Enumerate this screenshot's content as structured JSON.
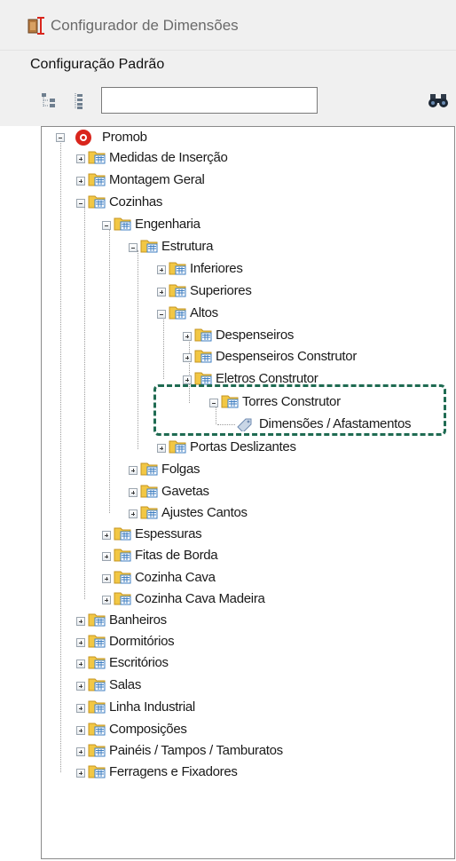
{
  "window": {
    "title": "Configurador de Dimensões"
  },
  "header": {
    "title": "Configuração Padrão"
  },
  "toolbar": {
    "search_value": "",
    "search_placeholder": ""
  },
  "colors": {
    "highlight": "#1f6b52",
    "folder": "#f4c842",
    "root_icon": "#d9251c"
  },
  "tree": {
    "root": "Promob",
    "nodes": [
      {
        "id": "medidas",
        "label": "Medidas de Inserção",
        "state": "collapsed"
      },
      {
        "id": "montagem",
        "label": "Montagem Geral",
        "state": "collapsed"
      },
      {
        "id": "cozinhas",
        "label": "Cozinhas",
        "state": "expanded"
      },
      {
        "id": "engenharia",
        "label": "Engenharia",
        "state": "expanded"
      },
      {
        "id": "estrutura",
        "label": "Estrutura",
        "state": "expanded"
      },
      {
        "id": "inferiores",
        "label": "Inferiores",
        "state": "collapsed"
      },
      {
        "id": "superiores",
        "label": "Superiores",
        "state": "collapsed"
      },
      {
        "id": "altos",
        "label": "Altos",
        "state": "expanded"
      },
      {
        "id": "despenseiros",
        "label": "Despenseiros",
        "state": "collapsed"
      },
      {
        "id": "despenseiros_construtor",
        "label": "Despenseiros Construtor",
        "state": "collapsed"
      },
      {
        "id": "eletros_construtor",
        "label": "Eletros Construtor",
        "state": "collapsed"
      },
      {
        "id": "torres_construtor",
        "label": "Torres Construtor",
        "state": "expanded"
      },
      {
        "id": "dimensoes",
        "label": "Dimensões / Afastamentos",
        "state": "leaf"
      },
      {
        "id": "portas",
        "label": "Portas Deslizantes",
        "state": "collapsed"
      },
      {
        "id": "folgas",
        "label": "Folgas",
        "state": "collapsed"
      },
      {
        "id": "gavetas",
        "label": "Gavetas",
        "state": "collapsed"
      },
      {
        "id": "ajustes",
        "label": "Ajustes Cantos",
        "state": "collapsed"
      },
      {
        "id": "espessuras",
        "label": "Espessuras",
        "state": "collapsed"
      },
      {
        "id": "fitas",
        "label": "Fitas de Borda",
        "state": "collapsed"
      },
      {
        "id": "cozinha_cava",
        "label": "Cozinha Cava",
        "state": "collapsed"
      },
      {
        "id": "cozinha_cava_madeira",
        "label": "Cozinha Cava Madeira",
        "state": "collapsed"
      },
      {
        "id": "banheiros",
        "label": "Banheiros",
        "state": "collapsed"
      },
      {
        "id": "dormitorios",
        "label": "Dormitórios",
        "state": "collapsed"
      },
      {
        "id": "escritorios",
        "label": "Escritórios",
        "state": "collapsed"
      },
      {
        "id": "salas",
        "label": "Salas",
        "state": "collapsed"
      },
      {
        "id": "linha_industrial",
        "label": "Linha Industrial",
        "state": "collapsed"
      },
      {
        "id": "composicoes",
        "label": "Composições",
        "state": "collapsed"
      },
      {
        "id": "paineis",
        "label": "Painéis / Tampos / Tamburatos",
        "state": "collapsed"
      },
      {
        "id": "ferragens",
        "label": "Ferragens e Fixadores",
        "state": "collapsed"
      }
    ]
  },
  "icons": {
    "app": "configurator-icon",
    "expand_all": "expand-all-icon",
    "collapse_all": "collapse-all-icon",
    "find": "binoculars-icon",
    "folder": "folder-icon",
    "leaf": "ruler-tag-icon"
  }
}
